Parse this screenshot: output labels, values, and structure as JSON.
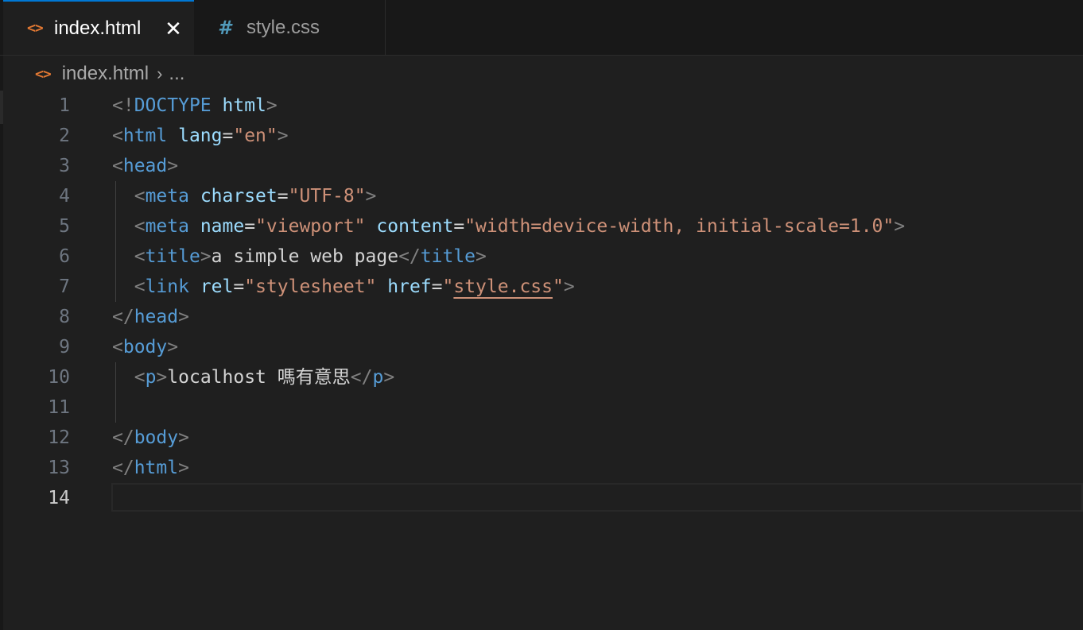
{
  "tabs": [
    {
      "icon": "html-file-icon",
      "label": "index.html",
      "active": true
    },
    {
      "icon": "css-file-icon",
      "label": "style.css",
      "active": false
    }
  ],
  "tab_icons": {
    "html": "<>",
    "css": "#",
    "close": "✕"
  },
  "breadcrumb": {
    "file": "index.html",
    "separator": "›",
    "more": "..."
  },
  "colors": {
    "accent": "#0078d4",
    "tag": "#569cd6",
    "attribute": "#9cdcfe",
    "string": "#ce9178"
  },
  "editor": {
    "current_line": 14,
    "lines": [
      {
        "n": "1",
        "t1": "DOCTYPE",
        "a1": "html"
      },
      {
        "n": "2",
        "t1": "html",
        "a1": "lang",
        "s1": "\"en\""
      },
      {
        "n": "3",
        "t1": "head"
      },
      {
        "n": "4",
        "t1": "meta",
        "a1": "charset",
        "s1": "\"UTF-8\""
      },
      {
        "n": "5",
        "t1": "meta",
        "a1": "name",
        "s1": "\"viewport\"",
        "a2": "content",
        "s2": "\"width=device-width, initial-scale=1.0\""
      },
      {
        "n": "6",
        "t1": "title",
        "x1": "a simple web page",
        "t2": "title"
      },
      {
        "n": "7",
        "t1": "link",
        "a1": "rel",
        "s1": "\"stylesheet\"",
        "a2": "href",
        "s2": "style.css"
      },
      {
        "n": "8",
        "t1": "head"
      },
      {
        "n": "9",
        "t1": "body"
      },
      {
        "n": "10",
        "t1": "p",
        "x1": "localhost 嗎有意思",
        "t2": "p"
      },
      {
        "n": "11"
      },
      {
        "n": "12",
        "t1": "body"
      },
      {
        "n": "13",
        "t1": "html"
      },
      {
        "n": "14"
      }
    ]
  }
}
